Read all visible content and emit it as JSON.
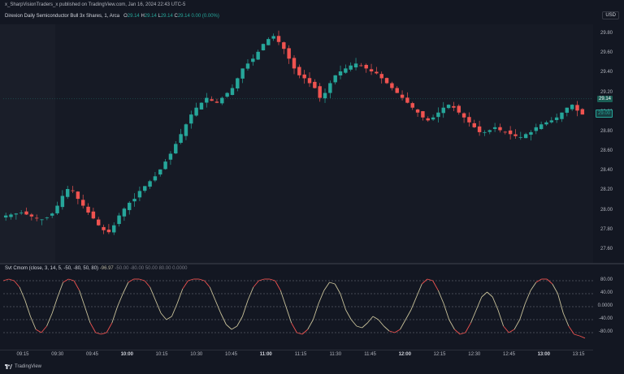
{
  "header": {
    "publisher": "x_SharpVisionTraders_x published on TradingView.com, Jan 16, 2024 22:43 UTC-5",
    "currency": "USD"
  },
  "legend": {
    "symbol": "Direxion Daily Semiconductor Bull 3x Shares, 1, Arca",
    "o_label": "O",
    "o_val": "29.14",
    "h_label": "H",
    "h_val": "29.14",
    "l_label": "L",
    "l_val": "29.14",
    "c_label": "C",
    "c_val": "29.14",
    "change": "0.00 (0.00%)"
  },
  "indicator": {
    "title": "Svt Cmom (close, 3, 14, 5, -50, -80, 50, 80)",
    "value": "-96.97",
    "params": "-50.00  -80.00  50.00  80.00  0.0000"
  },
  "price_axis": [
    "29.80",
    "29.60",
    "29.40",
    "29.20",
    "29.00",
    "28.80",
    "28.60",
    "28.40",
    "28.20",
    "28.00",
    "27.80",
    "27.60"
  ],
  "price_tags": {
    "last": "29.14",
    "current": "29.00"
  },
  "osc_axis": [
    "80.00",
    "40.00",
    "0.0000",
    "-40.00",
    "-80.00"
  ],
  "time_axis": [
    {
      "t": "09:15",
      "bold": false
    },
    {
      "t": "09:30",
      "bold": false
    },
    {
      "t": "09:45",
      "bold": false
    },
    {
      "t": "10:00",
      "bold": true
    },
    {
      "t": "10:15",
      "bold": false
    },
    {
      "t": "10:30",
      "bold": false
    },
    {
      "t": "10:45",
      "bold": false
    },
    {
      "t": "11:00",
      "bold": true
    },
    {
      "t": "11:15",
      "bold": false
    },
    {
      "t": "11:30",
      "bold": false
    },
    {
      "t": "11:45",
      "bold": false
    },
    {
      "t": "12:00",
      "bold": true
    },
    {
      "t": "12:15",
      "bold": false
    },
    {
      "t": "12:30",
      "bold": false
    },
    {
      "t": "12:45",
      "bold": false
    },
    {
      "t": "13:00",
      "bold": true
    },
    {
      "t": "13:15",
      "bold": false
    }
  ],
  "footer": {
    "brand": "TradingView"
  },
  "colors": {
    "up": "#26a69a",
    "down": "#ef5350",
    "osc": "#c9c29a",
    "osc_hot": "#ef5350"
  },
  "chart_data": {
    "type": "candlestick",
    "ylim": [
      27.5,
      29.9
    ],
    "osc_ylim": [
      -100,
      100
    ],
    "close_path": [
      27.95,
      27.96,
      27.97,
      27.98,
      27.96,
      27.94,
      27.92,
      27.91,
      27.93,
      27.97,
      28.05,
      28.15,
      28.22,
      28.2,
      28.12,
      28.05,
      27.98,
      27.92,
      27.85,
      27.8,
      27.78,
      27.85,
      27.95,
      28.02,
      28.08,
      28.12,
      28.2,
      28.25,
      28.3,
      28.35,
      28.42,
      28.5,
      28.58,
      28.68,
      28.78,
      28.88,
      28.98,
      29.05,
      29.1,
      29.15,
      29.12,
      29.1,
      29.15,
      29.2,
      29.25,
      29.35,
      29.45,
      29.5,
      29.55,
      29.62,
      29.7,
      29.75,
      29.78,
      29.72,
      29.65,
      29.55,
      29.45,
      29.38,
      29.35,
      29.3,
      29.25,
      29.15,
      29.2,
      29.3,
      29.38,
      29.42,
      29.45,
      29.48,
      29.5,
      29.48,
      29.45,
      29.42,
      29.4,
      29.35,
      29.3,
      29.25,
      29.2,
      29.15,
      29.1,
      29.05,
      29.0,
      28.95,
      28.92,
      28.95,
      29.0,
      29.05,
      29.08,
      29.05,
      29.0,
      28.95,
      28.9,
      28.85,
      28.8,
      28.8,
      28.82,
      28.85,
      28.82,
      28.8,
      28.78,
      28.76,
      28.75,
      28.78,
      28.8,
      28.85,
      28.88,
      28.9,
      28.92,
      28.95,
      29.0,
      29.05,
      29.08,
      29.02,
      28.98
    ],
    "osc_path": [
      80,
      85,
      80,
      60,
      20,
      -30,
      -70,
      -80,
      -60,
      -20,
      30,
      75,
      85,
      80,
      50,
      0,
      -50,
      -80,
      -85,
      -80,
      -50,
      0,
      40,
      75,
      85,
      85,
      80,
      60,
      20,
      -20,
      -40,
      -30,
      10,
      55,
      80,
      85,
      85,
      80,
      60,
      20,
      -20,
      -55,
      -70,
      -60,
      -30,
      20,
      60,
      80,
      85,
      85,
      80,
      50,
      0,
      -50,
      -80,
      -85,
      -70,
      -40,
      10,
      50,
      75,
      70,
      40,
      -10,
      -40,
      -60,
      -65,
      -50,
      -30,
      -40,
      -60,
      -75,
      -80,
      -70,
      -40,
      -10,
      30,
      70,
      85,
      80,
      50,
      10,
      -40,
      -70,
      -85,
      -80,
      -50,
      -10,
      30,
      45,
      30,
      -10,
      -60,
      -80,
      -70,
      -40,
      10,
      50,
      75,
      85,
      85,
      70,
      40,
      -20,
      -60,
      -85,
      -90,
      -97
    ]
  }
}
